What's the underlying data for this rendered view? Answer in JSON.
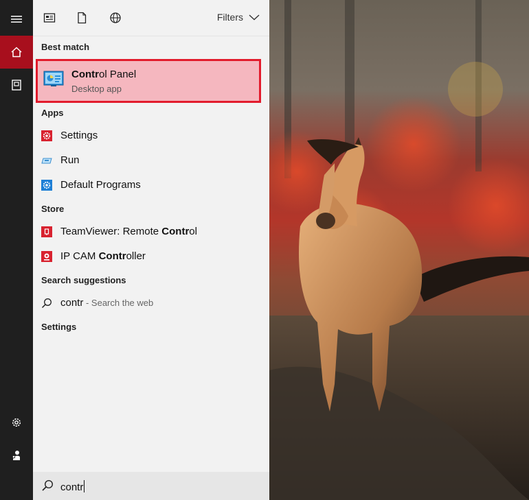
{
  "rail": {
    "items": [
      {
        "name": "menu",
        "icon": "hamburger-icon"
      },
      {
        "name": "home",
        "icon": "home-icon"
      },
      {
        "name": "documents",
        "icon": "notebook-icon"
      },
      {
        "name": "settings",
        "icon": "gear-icon"
      },
      {
        "name": "account",
        "icon": "user-icon"
      }
    ]
  },
  "topbar": {
    "filters_label": "Filters"
  },
  "sections": {
    "best_match": "Best match",
    "apps": "Apps",
    "store": "Store",
    "search_suggestions": "Search suggestions",
    "settings": "Settings"
  },
  "best_match": {
    "title_bold": "Contr",
    "title_rest": "ol Panel",
    "subtitle": "Desktop app"
  },
  "apps": [
    {
      "label": "Settings",
      "icon": "settings-gear-icon"
    },
    {
      "label": "Run",
      "icon": "run-icon"
    },
    {
      "label": "Default Programs",
      "icon": "default-programs-icon"
    }
  ],
  "store": [
    {
      "prefix": "TeamViewer: Remote ",
      "bold": "Contr",
      "suffix": "ol",
      "icon": "teamviewer-icon"
    },
    {
      "prefix": "IP CAM ",
      "bold": "Contr",
      "suffix": "oller",
      "icon": "ipcam-icon"
    }
  ],
  "suggestion": {
    "query": "contr",
    "hint": " - Search the web"
  },
  "search": {
    "value": "contr"
  },
  "colors": {
    "accent": "#a80f1d",
    "highlight": "#f5b7bf",
    "highlight_border": "#e21b2c"
  }
}
